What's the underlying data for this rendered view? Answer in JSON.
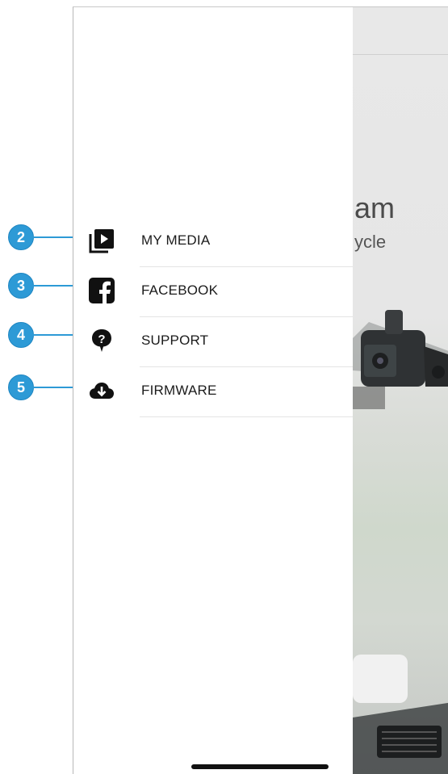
{
  "background_app": {
    "title_fragment": "am",
    "subtitle_fragment": "ycle"
  },
  "drawer": {
    "items": [
      {
        "label": "MY MEDIA",
        "icon": "video-library-icon"
      },
      {
        "label": "FACEBOOK",
        "icon": "facebook-icon"
      },
      {
        "label": "SUPPORT",
        "icon": "help-bubble-icon"
      },
      {
        "label": "FIRMWARE",
        "icon": "cloud-download-icon"
      }
    ]
  },
  "callouts": [
    "2",
    "3",
    "4",
    "5"
  ],
  "colors": {
    "callout": "#2d9ad6",
    "icon": "#111111",
    "label": "#1b1b1b",
    "divider": "#e4e4e4"
  }
}
